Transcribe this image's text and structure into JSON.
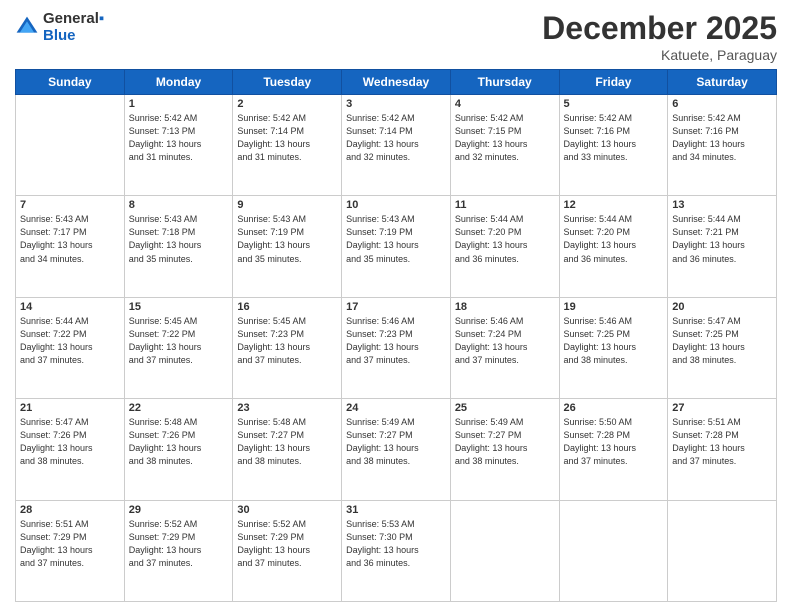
{
  "header": {
    "logo_line1": "General",
    "logo_line2": "Blue",
    "month_title": "December 2025",
    "subtitle": "Katuete, Paraguay"
  },
  "weekdays": [
    "Sunday",
    "Monday",
    "Tuesday",
    "Wednesday",
    "Thursday",
    "Friday",
    "Saturday"
  ],
  "weeks": [
    [
      {
        "day": "",
        "info": ""
      },
      {
        "day": "1",
        "info": "Sunrise: 5:42 AM\nSunset: 7:13 PM\nDaylight: 13 hours\nand 31 minutes."
      },
      {
        "day": "2",
        "info": "Sunrise: 5:42 AM\nSunset: 7:14 PM\nDaylight: 13 hours\nand 31 minutes."
      },
      {
        "day": "3",
        "info": "Sunrise: 5:42 AM\nSunset: 7:14 PM\nDaylight: 13 hours\nand 32 minutes."
      },
      {
        "day": "4",
        "info": "Sunrise: 5:42 AM\nSunset: 7:15 PM\nDaylight: 13 hours\nand 32 minutes."
      },
      {
        "day": "5",
        "info": "Sunrise: 5:42 AM\nSunset: 7:16 PM\nDaylight: 13 hours\nand 33 minutes."
      },
      {
        "day": "6",
        "info": "Sunrise: 5:42 AM\nSunset: 7:16 PM\nDaylight: 13 hours\nand 34 minutes."
      }
    ],
    [
      {
        "day": "7",
        "info": "Sunrise: 5:43 AM\nSunset: 7:17 PM\nDaylight: 13 hours\nand 34 minutes."
      },
      {
        "day": "8",
        "info": "Sunrise: 5:43 AM\nSunset: 7:18 PM\nDaylight: 13 hours\nand 35 minutes."
      },
      {
        "day": "9",
        "info": "Sunrise: 5:43 AM\nSunset: 7:19 PM\nDaylight: 13 hours\nand 35 minutes."
      },
      {
        "day": "10",
        "info": "Sunrise: 5:43 AM\nSunset: 7:19 PM\nDaylight: 13 hours\nand 35 minutes."
      },
      {
        "day": "11",
        "info": "Sunrise: 5:44 AM\nSunset: 7:20 PM\nDaylight: 13 hours\nand 36 minutes."
      },
      {
        "day": "12",
        "info": "Sunrise: 5:44 AM\nSunset: 7:20 PM\nDaylight: 13 hours\nand 36 minutes."
      },
      {
        "day": "13",
        "info": "Sunrise: 5:44 AM\nSunset: 7:21 PM\nDaylight: 13 hours\nand 36 minutes."
      }
    ],
    [
      {
        "day": "14",
        "info": "Sunrise: 5:44 AM\nSunset: 7:22 PM\nDaylight: 13 hours\nand 37 minutes."
      },
      {
        "day": "15",
        "info": "Sunrise: 5:45 AM\nSunset: 7:22 PM\nDaylight: 13 hours\nand 37 minutes."
      },
      {
        "day": "16",
        "info": "Sunrise: 5:45 AM\nSunset: 7:23 PM\nDaylight: 13 hours\nand 37 minutes."
      },
      {
        "day": "17",
        "info": "Sunrise: 5:46 AM\nSunset: 7:23 PM\nDaylight: 13 hours\nand 37 minutes."
      },
      {
        "day": "18",
        "info": "Sunrise: 5:46 AM\nSunset: 7:24 PM\nDaylight: 13 hours\nand 37 minutes."
      },
      {
        "day": "19",
        "info": "Sunrise: 5:46 AM\nSunset: 7:25 PM\nDaylight: 13 hours\nand 38 minutes."
      },
      {
        "day": "20",
        "info": "Sunrise: 5:47 AM\nSunset: 7:25 PM\nDaylight: 13 hours\nand 38 minutes."
      }
    ],
    [
      {
        "day": "21",
        "info": "Sunrise: 5:47 AM\nSunset: 7:26 PM\nDaylight: 13 hours\nand 38 minutes."
      },
      {
        "day": "22",
        "info": "Sunrise: 5:48 AM\nSunset: 7:26 PM\nDaylight: 13 hours\nand 38 minutes."
      },
      {
        "day": "23",
        "info": "Sunrise: 5:48 AM\nSunset: 7:27 PM\nDaylight: 13 hours\nand 38 minutes."
      },
      {
        "day": "24",
        "info": "Sunrise: 5:49 AM\nSunset: 7:27 PM\nDaylight: 13 hours\nand 38 minutes."
      },
      {
        "day": "25",
        "info": "Sunrise: 5:49 AM\nSunset: 7:27 PM\nDaylight: 13 hours\nand 38 minutes."
      },
      {
        "day": "26",
        "info": "Sunrise: 5:50 AM\nSunset: 7:28 PM\nDaylight: 13 hours\nand 37 minutes."
      },
      {
        "day": "27",
        "info": "Sunrise: 5:51 AM\nSunset: 7:28 PM\nDaylight: 13 hours\nand 37 minutes."
      }
    ],
    [
      {
        "day": "28",
        "info": "Sunrise: 5:51 AM\nSunset: 7:29 PM\nDaylight: 13 hours\nand 37 minutes."
      },
      {
        "day": "29",
        "info": "Sunrise: 5:52 AM\nSunset: 7:29 PM\nDaylight: 13 hours\nand 37 minutes."
      },
      {
        "day": "30",
        "info": "Sunrise: 5:52 AM\nSunset: 7:29 PM\nDaylight: 13 hours\nand 37 minutes."
      },
      {
        "day": "31",
        "info": "Sunrise: 5:53 AM\nSunset: 7:30 PM\nDaylight: 13 hours\nand 36 minutes."
      },
      {
        "day": "",
        "info": ""
      },
      {
        "day": "",
        "info": ""
      },
      {
        "day": "",
        "info": ""
      }
    ]
  ]
}
